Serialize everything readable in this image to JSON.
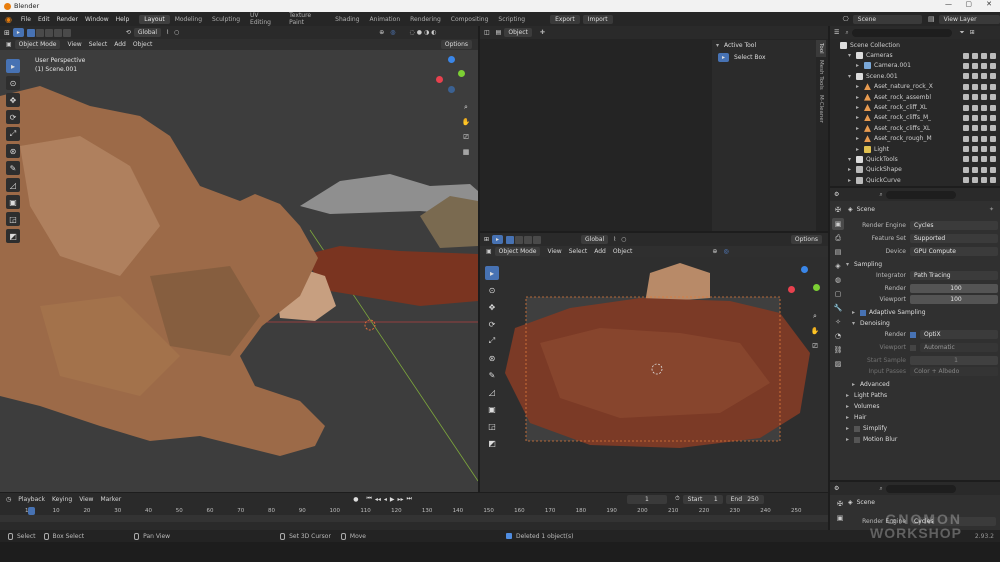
{
  "app": {
    "title": "Blender"
  },
  "menu": [
    "File",
    "Edit",
    "Render",
    "Window",
    "Help"
  ],
  "workspaces": [
    {
      "label": "Layout",
      "active": true
    },
    {
      "label": "Modeling"
    },
    {
      "label": "Sculpting"
    },
    {
      "label": "UV Editing"
    },
    {
      "label": "Texture Paint"
    },
    {
      "label": "Shading"
    },
    {
      "label": "Animation"
    },
    {
      "label": "Rendering"
    },
    {
      "label": "Compositing"
    },
    {
      "label": "Scripting"
    }
  ],
  "topbar": {
    "export": "Export",
    "import": "Import",
    "scene": "Scene",
    "view_layer": "View Layer"
  },
  "viewport_main": {
    "mode": "Object Mode",
    "menus": [
      "View",
      "Select",
      "Add",
      "Object"
    ],
    "orientation": "Global",
    "options": "Options",
    "perspective": "User Perspective",
    "collection": "(1) Scene.001"
  },
  "image_editor": {
    "menu": "Object",
    "panel_title": "Active Tool",
    "tool_name": "Select Box",
    "side_tabs": [
      "Tool",
      "Mesh Tools",
      "M-Cleaner"
    ]
  },
  "viewport_small": {
    "mode": "Object Mode",
    "menus": [
      "View",
      "Select",
      "Add",
      "Object"
    ],
    "orientation": "Global",
    "options": "Options"
  },
  "outliner": {
    "root": "Scene Collection",
    "items": [
      {
        "name": "Cameras",
        "type": "collection",
        "indent": 1
      },
      {
        "name": "Camera.001",
        "type": "camera",
        "indent": 2
      },
      {
        "name": "Scene.001",
        "type": "collection",
        "indent": 1
      },
      {
        "name": "Aset_nature_rock_X",
        "type": "mesh",
        "indent": 2
      },
      {
        "name": "Aset_rock_assembl",
        "type": "mesh",
        "indent": 2
      },
      {
        "name": "Aset_rock_cliff_XL",
        "type": "mesh",
        "indent": 2
      },
      {
        "name": "Aset_rock_cliffs_M_",
        "type": "mesh",
        "indent": 2
      },
      {
        "name": "Aset_rock_cliffs_XL",
        "type": "mesh",
        "indent": 2
      },
      {
        "name": "Aset_rock_rough_M",
        "type": "mesh",
        "indent": 2
      },
      {
        "name": "Light",
        "type": "light",
        "indent": 2
      },
      {
        "name": "QuickTools",
        "type": "collection",
        "indent": 1
      },
      {
        "name": "QuickShape",
        "type": "object",
        "indent": 1
      },
      {
        "name": "QuickCurve",
        "type": "object",
        "indent": 1
      }
    ]
  },
  "properties": {
    "scene_label": "Scene",
    "render_engine": {
      "label": "Render Engine",
      "value": "Cycles"
    },
    "feature_set": {
      "label": "Feature Set",
      "value": "Supported"
    },
    "device": {
      "label": "Device",
      "value": "GPU Compute"
    },
    "sampling": "Sampling",
    "integrator": {
      "label": "Integrator",
      "value": "Path Tracing"
    },
    "render_samples": {
      "label": "Render",
      "value": "100"
    },
    "viewport_samples": {
      "label": "Viewport",
      "value": "100"
    },
    "adaptive": "Adaptive Sampling",
    "denoising": "Denoising",
    "den_render": {
      "label": "Render",
      "value": "OptiX"
    },
    "den_viewport": {
      "label": "Viewport",
      "value": "Automatic"
    },
    "start_sample": {
      "label": "Start Sample",
      "value": "1"
    },
    "input_passes": {
      "label": "Input Passes",
      "value": "Color + Albedo"
    },
    "sections": [
      "Advanced",
      "Light Paths",
      "Volumes",
      "Hair",
      "Simplify",
      "Motion Blur"
    ]
  },
  "properties2": {
    "scene_label": "Scene",
    "render_engine": {
      "label": "Render Engine",
      "value": "Cycles"
    }
  },
  "timeline": {
    "menus": [
      "Playback",
      "Keying",
      "View",
      "Marker"
    ],
    "current": "1",
    "start_label": "Start",
    "start": "1",
    "end_label": "End",
    "end": "250",
    "ticks": [
      "1",
      "10",
      "20",
      "30",
      "40",
      "50",
      "60",
      "70",
      "80",
      "90",
      "100",
      "110",
      "120",
      "130",
      "140",
      "150",
      "160",
      "170",
      "180",
      "190",
      "200",
      "210",
      "220",
      "230",
      "240",
      "250"
    ]
  },
  "status": {
    "select": "Select",
    "box_select": "Box Select",
    "pan_view": "Pan View",
    "set_cursor": "Set 3D Cursor",
    "move": "Move",
    "message": "Deleted 1 object(s)",
    "version": "2.93.2"
  },
  "watermark": {
    "line1": "GNOMON",
    "line2": "WORKSHOP"
  },
  "colors": {
    "accent": "#4772b3",
    "header": "#2a2a2a",
    "panel": "#303030",
    "x_axis": "#e8414e",
    "y_axis": "#7ccf34",
    "z_axis": "#3a86e8"
  }
}
